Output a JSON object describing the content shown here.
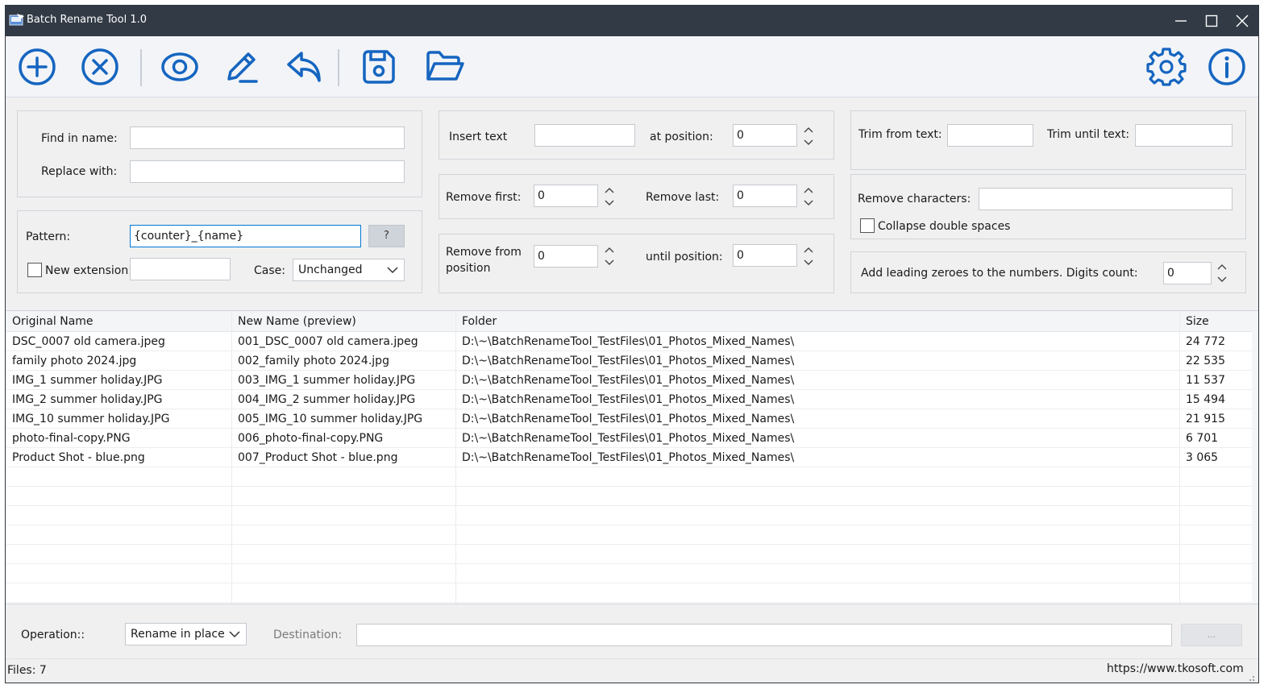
{
  "window": {
    "title": "Batch Rename Tool 1.0"
  },
  "colors": {
    "accent": "#1565c0",
    "titlebar": "#323a45"
  },
  "toolbar": {
    "buttons": [
      {
        "icon": "plus-circle-icon",
        "name": "add-files-button"
      },
      {
        "icon": "x-circle-icon",
        "name": "remove-files-button"
      },
      {
        "icon": "eye-icon",
        "name": "preview-button"
      },
      {
        "icon": "pencil-icon",
        "name": "rename-button"
      },
      {
        "icon": "undo-arrow-icon",
        "name": "undo-button"
      },
      {
        "icon": "save-icon",
        "name": "save-button"
      },
      {
        "icon": "folder-open-icon",
        "name": "open-button"
      },
      {
        "icon": "gear-icon",
        "name": "settings-button"
      },
      {
        "icon": "info-icon",
        "name": "about-button"
      }
    ]
  },
  "find_replace": {
    "find_label": "Find in name:",
    "find_value": "",
    "replace_label": "Replace with:",
    "replace_value": ""
  },
  "pattern": {
    "pattern_label": "Pattern:",
    "pattern_value": "{counter}_{name}",
    "help_label": "?",
    "new_ext_label": "New extension:",
    "new_ext_value": "",
    "case_label": "Case:",
    "case_value": "Unchanged"
  },
  "insert": {
    "insert_label": "Insert text",
    "insert_value": "",
    "at_position_label": "at position:",
    "at_position_value": "0"
  },
  "remove_fl": {
    "first_label": "Remove first:",
    "first_value": "0",
    "last_label": "Remove last:",
    "last_value": "0"
  },
  "remove_range": {
    "from_label_1": "Remove from",
    "from_label_2": "position",
    "from_value": "0",
    "until_label": "until position:",
    "until_value": "0"
  },
  "trim": {
    "from_label": "Trim from text:",
    "from_value": "",
    "until_label": "Trim until text:",
    "until_value": ""
  },
  "remove_chars": {
    "label": "Remove characters:",
    "value": "",
    "collapse_label": "Collapse double spaces",
    "collapse_checked": false
  },
  "leading_zeroes": {
    "label": "Add leading zeroes to the numbers. Digits count:",
    "value": "0"
  },
  "grid": {
    "columns": [
      "Original Name",
      "New Name (preview)",
      "Folder",
      "Size"
    ],
    "rows": [
      {
        "original": "DSC_0007 old camera.jpeg",
        "preview": "001_DSC_0007 old camera.jpeg",
        "folder": "D:\\~\\BatchRenameTool_TestFiles\\01_Photos_Mixed_Names\\",
        "size": "24 772"
      },
      {
        "original": "family  photo  2024.jpg",
        "preview": "002_family  photo  2024.jpg",
        "folder": "D:\\~\\BatchRenameTool_TestFiles\\01_Photos_Mixed_Names\\",
        "size": "22 535"
      },
      {
        "original": "IMG_1  summer holiday.JPG",
        "preview": "003_IMG_1  summer holiday.JPG",
        "folder": "D:\\~\\BatchRenameTool_TestFiles\\01_Photos_Mixed_Names\\",
        "size": "11 537"
      },
      {
        "original": "IMG_2  summer holiday.JPG",
        "preview": "004_IMG_2  summer holiday.JPG",
        "folder": "D:\\~\\BatchRenameTool_TestFiles\\01_Photos_Mixed_Names\\",
        "size": "15 494"
      },
      {
        "original": "IMG_10  summer holiday.JPG",
        "preview": "005_IMG_10  summer holiday.JPG",
        "folder": "D:\\~\\BatchRenameTool_TestFiles\\01_Photos_Mixed_Names\\",
        "size": "21 915"
      },
      {
        "original": "photo-final-copy.PNG",
        "preview": "006_photo-final-copy.PNG",
        "folder": "D:\\~\\BatchRenameTool_TestFiles\\01_Photos_Mixed_Names\\",
        "size": "6 701"
      },
      {
        "original": "Product Shot - blue.png",
        "preview": "007_Product Shot - blue.png",
        "folder": "D:\\~\\BatchRenameTool_TestFiles\\01_Photos_Mixed_Names\\",
        "size": "3 065"
      }
    ]
  },
  "operation": {
    "label": "Operation::",
    "value": "Rename in place",
    "destination_label": "Destination:",
    "destination_value": "",
    "browse_label": "..."
  },
  "status": {
    "files": "Files: 7",
    "url": "https://www.tkosoft.com"
  }
}
